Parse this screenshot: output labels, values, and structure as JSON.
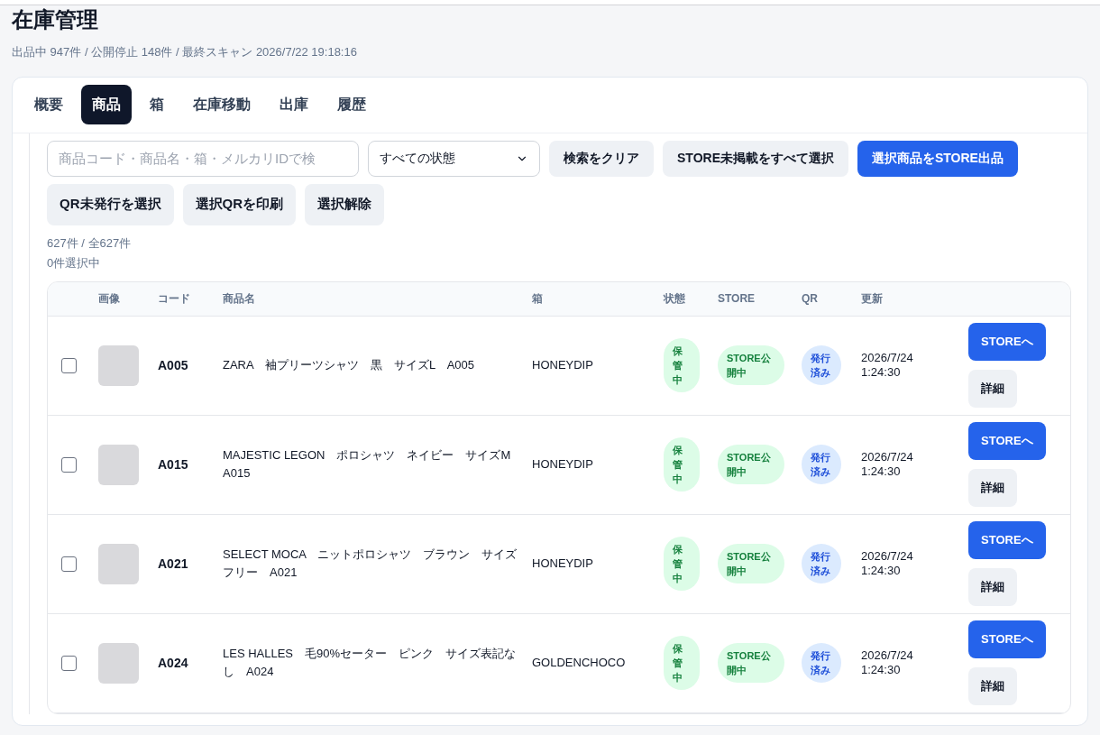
{
  "page": {
    "title": "在庫管理",
    "summary": "出品中 947件 / 公開停止 148件 / 最終スキャン 2026/7/22 19:18:16"
  },
  "tabs": [
    {
      "label": "概要",
      "selected": false
    },
    {
      "label": "商品",
      "selected": true
    },
    {
      "label": "箱",
      "selected": false
    },
    {
      "label": "在庫移動",
      "selected": false
    },
    {
      "label": "出庫",
      "selected": false
    },
    {
      "label": "履歴",
      "selected": false
    }
  ],
  "filters": {
    "search": {
      "placeholder": "商品コード・商品名・箱・メルカリIDで検"
    },
    "status_select": {
      "value": "すべての状態"
    },
    "buttons": [
      {
        "label": "検索をクリア",
        "kind": "secondary"
      },
      {
        "label": "STORE未掲載をすべて選択",
        "kind": "secondary"
      },
      {
        "label": "選択商品をSTORE出品",
        "kind": "primary"
      }
    ]
  },
  "qr_buttons": [
    "QR未発行を選択",
    "選択QRを印刷",
    "選択解除"
  ],
  "counts": {
    "shown": "627件 / 全627件",
    "selected": "0件選択中"
  },
  "table": {
    "columns": [
      "画像",
      "コード",
      "商品名",
      "箱",
      "状態",
      "STORE",
      "QR",
      "更新"
    ],
    "rows": [
      {
        "checked": false,
        "code": "A005",
        "name": "ZARA　袖プリーツシャツ　黒　サイズL　A005",
        "box": "HONEYDIP",
        "status": "保管中",
        "store": "STORE公開中",
        "qr": "発行済み",
        "updated": "2026/7/24 1:24:30",
        "actions": [
          "STOREへ",
          "詳細"
        ]
      },
      {
        "checked": false,
        "code": "A015",
        "name": "MAJESTIC LEGON　ポロシャツ　ネイビー　サイズM　A015",
        "box": "HONEYDIP",
        "status": "保管中",
        "store": "STORE公開中",
        "qr": "発行済み",
        "updated": "2026/7/24 1:24:30",
        "actions": [
          "STOREへ",
          "詳細"
        ]
      },
      {
        "checked": false,
        "code": "A021",
        "name": "SELECT MOCA　ニットポロシャツ　ブラウン　サイズフリー　A021",
        "box": "HONEYDIP",
        "status": "保管中",
        "store": "STORE公開中",
        "qr": "発行済み",
        "updated": "2026/7/24 1:24:30",
        "actions": [
          "STOREへ",
          "詳細"
        ]
      },
      {
        "checked": false,
        "code": "A024",
        "name": "LES HALLES　毛90%セーター　ピンク　サイズ表記なし　A024",
        "box": "GOLDENCHOCO",
        "status": "保管中",
        "store": "STORE公開中",
        "qr": "発行済み",
        "updated": "2026/7/24 1:24:30",
        "actions": [
          "STOREへ",
          "詳細"
        ]
      }
    ]
  }
}
